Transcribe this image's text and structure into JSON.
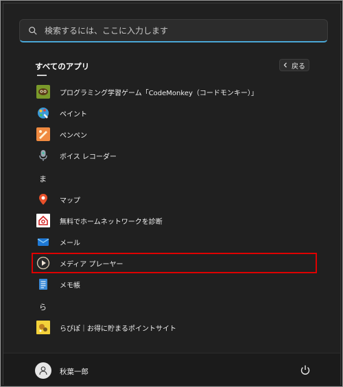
{
  "search": {
    "placeholder": "検索するには、ここに入力します"
  },
  "section": {
    "title": "すべてのアプリ",
    "back_label": "戻る"
  },
  "apps": [
    {
      "name": "プログラミング学習ゲーム「CodeMonkey（コードモンキー）」",
      "icon": "codemonkey-icon"
    },
    {
      "name": "ペイント",
      "icon": "paint-icon"
    },
    {
      "name": "ペンペン",
      "icon": "penpen-icon"
    },
    {
      "name": "ボイス レコーダー",
      "icon": "voice-recorder-icon"
    }
  ],
  "letter_ma": "ま",
  "apps_ma": [
    {
      "name": "マップ",
      "icon": "maps-icon"
    },
    {
      "name": "無料でホームネットワークを診断",
      "icon": "home-network-icon"
    },
    {
      "name": "メール",
      "icon": "mail-icon"
    },
    {
      "name": "メディア プレーヤー",
      "icon": "media-player-icon"
    },
    {
      "name": "メモ帳",
      "icon": "notepad-icon"
    }
  ],
  "letter_ra": "ら",
  "apps_ra": [
    {
      "name": "らぴぽ｜お得に貯まるポイントサイト",
      "icon": "rapipo-icon"
    }
  ],
  "user": {
    "name": "秋葉一郎"
  },
  "colors": {
    "accent": "#4aa8d8",
    "highlight": "#e00000",
    "background": "#202020"
  }
}
